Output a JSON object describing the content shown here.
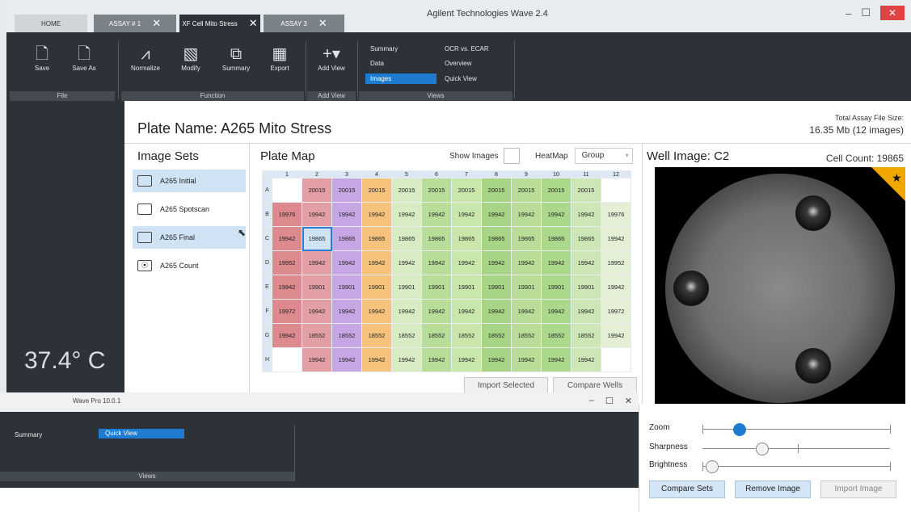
{
  "app": {
    "title": "Agilent Technologies Wave 2.4",
    "tabs": [
      {
        "label": "HOME"
      },
      {
        "label": "ASSAY # 1"
      },
      {
        "label": "XF Cell Mito Stress"
      },
      {
        "label": "ASSAY 3"
      }
    ],
    "window_controls": {
      "minimize": "–",
      "maximize": "☐",
      "close": "✕"
    }
  },
  "ribbon": {
    "file": {
      "save": "Save",
      "save_as": "Save As",
      "group": "File"
    },
    "function": {
      "normalize": "Normalize",
      "modify": "Modify",
      "summary": "Summary",
      "export": "Export",
      "group": "Function"
    },
    "add_view": {
      "label": "Add View",
      "group": "Add View"
    },
    "views": {
      "summary": "Summary",
      "data": "Data",
      "images": "Images",
      "ocr_ecar": "OCR vs. ECAR",
      "overview": "Overview",
      "quick_view": "Quick View",
      "group": "Views"
    }
  },
  "temperature": "37.4° C",
  "page": {
    "title": "Plate Name: A265 Mito Stress",
    "file_size_label": "Total Assay File Size:",
    "file_size_value": "16.35 Mb (12 images)"
  },
  "image_sets": {
    "header": "Image Sets",
    "items": [
      {
        "label": "A265 Initial"
      },
      {
        "label": "A265 Spotscan"
      },
      {
        "label": "A265 Final"
      },
      {
        "label": "A265 Count"
      }
    ]
  },
  "plate_map": {
    "header": "Plate Map",
    "show_images": "Show Images",
    "heatmap": "HeatMap",
    "group_select": "Group",
    "columns": [
      "1",
      "2",
      "3",
      "4",
      "5",
      "6",
      "7",
      "8",
      "9",
      "10",
      "11",
      "12"
    ],
    "rows": [
      "A",
      "B",
      "C",
      "D",
      "E",
      "F",
      "G",
      "H"
    ],
    "cells": [
      [
        "",
        "20015",
        "20015",
        "20015",
        "20015",
        "20015",
        "20015",
        "20015",
        "20015",
        "20015",
        "20015",
        ""
      ],
      [
        "19976",
        "19942",
        "19942",
        "19942",
        "19942",
        "19942",
        "19942",
        "19942",
        "19942",
        "19942",
        "19942",
        "19976"
      ],
      [
        "19942",
        "19865",
        "19865",
        "19865",
        "19865",
        "19865",
        "19865",
        "19865",
        "19865",
        "19865",
        "19865",
        "19942"
      ],
      [
        "19952",
        "19942",
        "19942",
        "19942",
        "19942",
        "19942",
        "19942",
        "19942",
        "19942",
        "19942",
        "19942",
        "19952"
      ],
      [
        "19942",
        "19901",
        "19901",
        "19901",
        "19901",
        "19901",
        "19901",
        "19901",
        "19901",
        "19901",
        "19901",
        "19942"
      ],
      [
        "19972",
        "19942",
        "19942",
        "19942",
        "19942",
        "19942",
        "19942",
        "19942",
        "19942",
        "19942",
        "19942",
        "19972"
      ],
      [
        "19942",
        "18552",
        "18552",
        "18552",
        "18552",
        "18552",
        "18552",
        "18552",
        "18552",
        "18552",
        "18552",
        "19942"
      ],
      [
        "",
        "19942",
        "19942",
        "19942",
        "19942",
        "19942",
        "19942",
        "19942",
        "19942",
        "19942",
        "19942",
        ""
      ]
    ],
    "colors": {
      "col1": "#dc8a8e",
      "col2": "#e3a0a4",
      "col3": "#c6a6e4",
      "col4": "#f6c37c",
      "col5": "#d8ecc4",
      "col6": "#b8dd98",
      "col7": "#c9e6ab",
      "col8": "#a8d585",
      "col9": "#b9dd98",
      "col10": "#acd88c",
      "col11": "#cde6b6",
      "col12": "#e3f0d6"
    },
    "import_selected": "Import Selected",
    "compare_wells": "Compare Wells"
  },
  "well": {
    "header": "Well Image: C2",
    "cell_count": "Cell Count: 19865"
  },
  "sliders": [
    {
      "label": "Zoom",
      "value": 0.2
    },
    {
      "label": "Sharpness",
      "value": 0.32
    },
    {
      "label": "Brightness",
      "value": 0.05
    }
  ],
  "buttons": {
    "compare_sets": "Compare Sets",
    "remove_image": "Remove Image",
    "import_image": "Import Image"
  },
  "second_window": {
    "title": "Wave Pro 10.0.1",
    "summary": "Summary",
    "quick_view": "Quick View",
    "views": "Views",
    "controls": {
      "minimize": "–",
      "maximize": "☐",
      "close": "✕"
    }
  }
}
